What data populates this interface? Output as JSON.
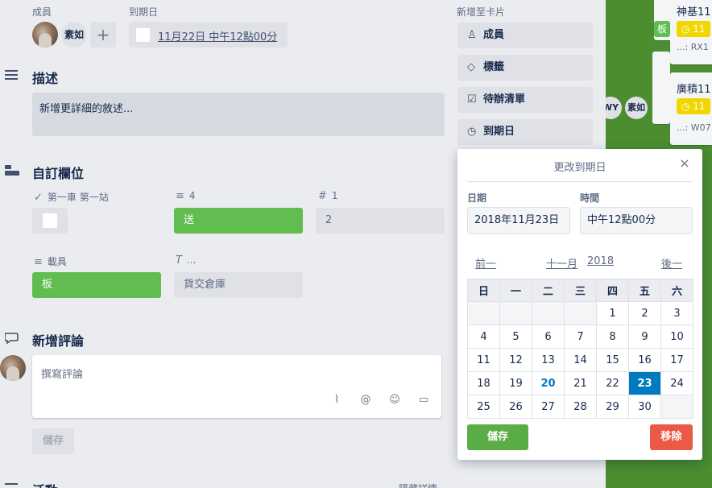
{
  "header": {
    "members_label": "成員",
    "due_label": "到期日",
    "member_name": "素如",
    "add_member": "+",
    "due_value": "11月22日 中午12點00分"
  },
  "description": {
    "title": "描述",
    "placeholder": "新增更詳細的敘述..."
  },
  "custom_fields": {
    "title": "自訂欄位",
    "fields": [
      {
        "label": "第一車 第一站",
        "value": ""
      },
      {
        "label": "4",
        "value": "送"
      },
      {
        "label": "1",
        "value": "2"
      },
      {
        "label": "載具",
        "value": "板"
      },
      {
        "label": "...",
        "value": "貨交倉庫"
      }
    ]
  },
  "comment": {
    "title": "新增評論",
    "placeholder": "撰寫評論",
    "save": "儲存"
  },
  "activity": {
    "title": "活動",
    "hide_details": "隱藏詳情"
  },
  "sidebar": {
    "heading": "新增至卡片",
    "buttons": [
      "成員",
      "標籤",
      "待辦清單",
      "到期日"
    ]
  },
  "date_popover": {
    "title": "更改到期日",
    "close": "×",
    "date_label": "日期",
    "time_label": "時間",
    "date_value": "2018年11月23日",
    "time_value": "中午12點00分",
    "prev": "前一",
    "month": "十一月",
    "year": "2018",
    "next": "後一",
    "weekdays": [
      "日",
      "一",
      "二",
      "三",
      "四",
      "五",
      "六"
    ],
    "weeks": [
      [
        "",
        "",
        "",
        "",
        "1",
        "2",
        "3"
      ],
      [
        "4",
        "5",
        "6",
        "7",
        "8",
        "9",
        "10"
      ],
      [
        "11",
        "12",
        "13",
        "14",
        "15",
        "16",
        "17"
      ],
      [
        "18",
        "19",
        "20",
        "21",
        "22",
        "23",
        "24"
      ],
      [
        "25",
        "26",
        "27",
        "28",
        "29",
        "30",
        ""
      ]
    ],
    "today": "20",
    "selected": "23",
    "save": "儲存",
    "remove": "移除"
  },
  "background": {
    "card1_title": "神基11",
    "card1_due": "11",
    "card1_sub": "...: RX1",
    "card2_title": "廣積11",
    "card2_due": "11",
    "card2_sub": "...: W07",
    "badge": "板",
    "member_wy": "WY",
    "member_sr": "素如"
  },
  "colors": {
    "accent_blue": "#0079bf",
    "green": "#61bd4f",
    "save_green": "#5aac44",
    "remove_red": "#eb5a46",
    "due_yellow": "#f2d600"
  }
}
